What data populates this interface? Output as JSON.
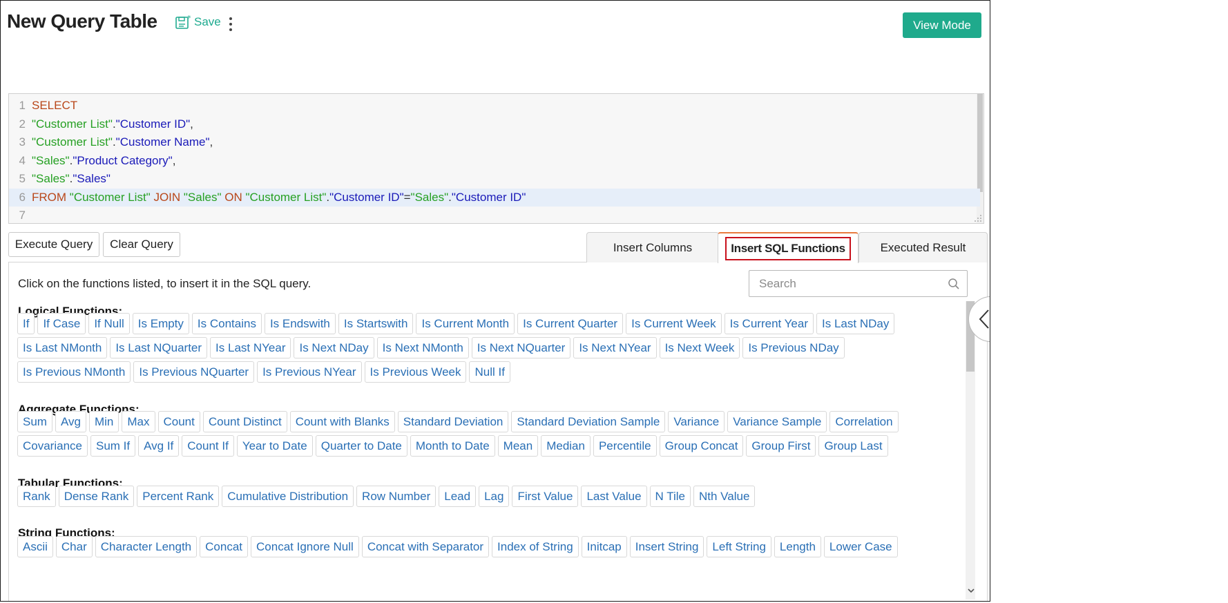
{
  "header": {
    "title": "New Query Table",
    "save_label": "Save",
    "view_mode_label": "View Mode"
  },
  "editor": {
    "lines": [
      {
        "n": "1",
        "tokens": [
          {
            "t": "SELECT",
            "c": "kw"
          }
        ]
      },
      {
        "n": "2",
        "tokens": [
          {
            "t": "\"Customer List\"",
            "c": "tbl"
          },
          {
            "t": ".",
            "c": "txt"
          },
          {
            "t": "\"Customer ID\"",
            "c": "col"
          },
          {
            "t": ",",
            "c": "txt"
          }
        ]
      },
      {
        "n": "3",
        "tokens": [
          {
            "t": "\"Customer List\"",
            "c": "tbl"
          },
          {
            "t": ".",
            "c": "txt"
          },
          {
            "t": "\"Customer Name\"",
            "c": "col"
          },
          {
            "t": ",",
            "c": "txt"
          }
        ]
      },
      {
        "n": "4",
        "tokens": [
          {
            "t": "\"Sales\"",
            "c": "tbl"
          },
          {
            "t": ".",
            "c": "txt"
          },
          {
            "t": "\"Product Category\"",
            "c": "col"
          },
          {
            "t": ",",
            "c": "txt"
          }
        ]
      },
      {
        "n": "5",
        "tokens": [
          {
            "t": "\"Sales\"",
            "c": "tbl"
          },
          {
            "t": ".",
            "c": "txt"
          },
          {
            "t": "\"Sales\"",
            "c": "col"
          }
        ]
      },
      {
        "n": "6",
        "tokens": [
          {
            "t": "FROM ",
            "c": "kw"
          },
          {
            "t": "\"Customer List\"",
            "c": "tbl"
          },
          {
            "t": " JOIN ",
            "c": "kw"
          },
          {
            "t": "\"Sales\"",
            "c": "tbl"
          },
          {
            "t": " ON ",
            "c": "kw"
          },
          {
            "t": "\"Customer List\"",
            "c": "tbl"
          },
          {
            "t": ".",
            "c": "txt"
          },
          {
            "t": "\"Customer ID\"",
            "c": "col"
          },
          {
            "t": "=",
            "c": "txt"
          },
          {
            "t": "\"Sales\"",
            "c": "tbl"
          },
          {
            "t": ".",
            "c": "txt"
          },
          {
            "t": "\"Customer ID\"",
            "c": "col"
          }
        ]
      },
      {
        "n": "7",
        "tokens": []
      }
    ],
    "active_line": "6"
  },
  "actions": {
    "execute_label": "Execute Query",
    "clear_label": "Clear Query"
  },
  "tabs": {
    "insert_columns": "Insert Columns",
    "insert_sql_functions": "Insert SQL Functions",
    "executed_result": "Executed Result"
  },
  "panel": {
    "instruction": "Click on the functions listed, to insert it in the SQL query.",
    "search_placeholder": "Search",
    "sections": [
      {
        "title": "Logical Functions:",
        "rows": [
          [
            "If",
            "If Case",
            "If Null",
            "Is Empty",
            "Is Contains",
            "Is Endswith",
            "Is Startswith",
            "Is Current Month",
            "Is Current Quarter",
            "Is Current Week",
            "Is Current Year",
            "Is Last NDay"
          ],
          [
            "Is Last NMonth",
            "Is Last NQuarter",
            "Is Last NYear",
            "Is Next NDay",
            "Is Next NMonth",
            "Is Next NQuarter",
            "Is Next NYear",
            "Is Next Week",
            "Is Previous NDay"
          ],
          [
            "Is Previous NMonth",
            "Is Previous NQuarter",
            "Is Previous NYear",
            "Is Previous Week",
            "Null If"
          ]
        ]
      },
      {
        "title": "Aggregate Functions:",
        "rows": [
          [
            "Sum",
            "Avg",
            "Min",
            "Max",
            "Count",
            "Count Distinct",
            "Count with Blanks",
            "Standard Deviation",
            "Standard Deviation Sample",
            "Variance",
            "Variance Sample",
            "Correlation"
          ],
          [
            "Covariance",
            "Sum If",
            "Avg If",
            "Count If",
            "Year to Date",
            "Quarter to Date",
            "Month to Date",
            "Mean",
            "Median",
            "Percentile",
            "Group Concat",
            "Group First",
            "Group Last"
          ]
        ]
      },
      {
        "title": "Tabular Functions:",
        "rows": [
          [
            "Rank",
            "Dense Rank",
            "Percent Rank",
            "Cumulative Distribution",
            "Row Number",
            "Lead",
            "Lag",
            "First Value",
            "Last Value",
            "N Tile",
            "Nth Value"
          ]
        ]
      },
      {
        "title": "String Functions:",
        "rows": [
          [
            "Ascii",
            "Char",
            "Character Length",
            "Concat",
            "Concat Ignore Null",
            "Concat with Separator",
            "Index of String",
            "Initcap",
            "Insert String",
            "Left String",
            "Length",
            "Lower Case"
          ]
        ]
      }
    ]
  }
}
